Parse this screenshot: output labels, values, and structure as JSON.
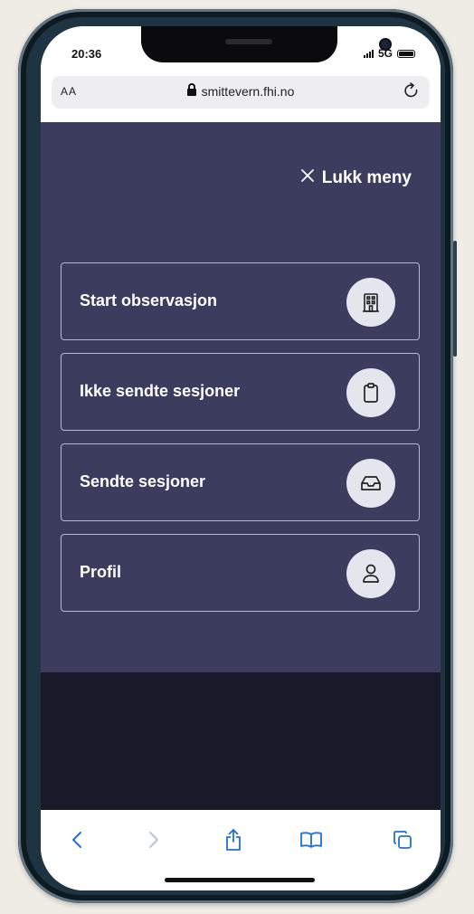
{
  "status_bar": {
    "time": "20:36",
    "network": "5G"
  },
  "browser": {
    "aa_label": "AA",
    "url": "smittevern.fhi.no",
    "reload_icon": "reload-icon"
  },
  "menu": {
    "close_label": "Lukk meny",
    "items": [
      {
        "label": "Start observasjon",
        "icon": "building-icon"
      },
      {
        "label": "Ikke sendte sesjoner",
        "icon": "clipboard-icon"
      },
      {
        "label": "Sendte sesjoner",
        "icon": "inbox-icon"
      },
      {
        "label": "Profil",
        "icon": "user-icon"
      }
    ]
  },
  "toolbar": {
    "buttons": [
      "back-icon",
      "forward-icon",
      "share-icon",
      "bookmarks-icon",
      "tabs-icon"
    ]
  },
  "colors": {
    "menu_background": "#3b3c5e",
    "page_dark": "#181929",
    "accent_blue": "#1f6fd8",
    "icon_circle": "#e4e6ee"
  }
}
